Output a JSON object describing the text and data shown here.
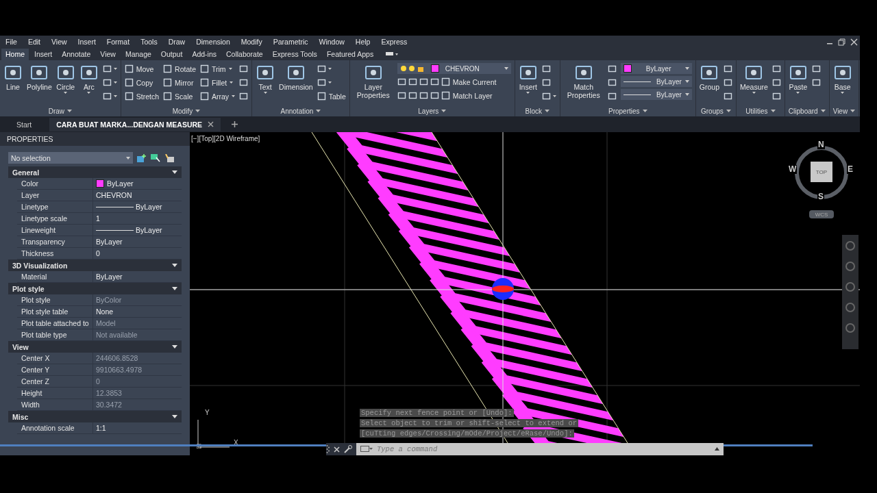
{
  "menu": [
    "File",
    "Edit",
    "View",
    "Insert",
    "Format",
    "Tools",
    "Draw",
    "Dimension",
    "Modify",
    "Parametric",
    "Window",
    "Help",
    "Express"
  ],
  "ribbon_tabs": [
    {
      "label": "Home",
      "selected": true
    },
    {
      "label": "Insert",
      "selected": false
    },
    {
      "label": "Annotate",
      "selected": false
    },
    {
      "label": "View",
      "selected": false
    },
    {
      "label": "Manage",
      "selected": false
    },
    {
      "label": "Output",
      "selected": false
    },
    {
      "label": "Add-ins",
      "selected": false
    },
    {
      "label": "Collaborate",
      "selected": false
    },
    {
      "label": "Express Tools",
      "selected": false
    },
    {
      "label": "Featured Apps",
      "selected": false
    }
  ],
  "panels": [
    {
      "title": "Draw",
      "columns": [
        [
          {
            "kind": "large",
            "label": "Line",
            "caret": false
          }
        ],
        [
          {
            "kind": "large",
            "label": "Polyline",
            "caret": false
          }
        ],
        [
          {
            "kind": "large",
            "label": "Circle",
            "caret": true
          }
        ],
        [
          {
            "kind": "large",
            "label": "Arc",
            "caret": true
          }
        ],
        [
          {
            "kind": "icon",
            "caret": true
          },
          {
            "kind": "icon",
            "caret": true
          },
          {
            "kind": "icon",
            "caret": true
          }
        ]
      ]
    },
    {
      "title": "Modify",
      "columns": [
        [
          {
            "kind": "small",
            "label": "Move",
            "caret": false
          },
          {
            "kind": "small",
            "label": "Copy",
            "caret": false
          },
          {
            "kind": "small",
            "label": "Stretch",
            "caret": false
          }
        ],
        [
          {
            "kind": "small",
            "label": "Rotate",
            "caret": false
          },
          {
            "kind": "small",
            "label": "Mirror",
            "caret": false
          },
          {
            "kind": "small",
            "label": "Scale",
            "caret": false
          }
        ],
        [
          {
            "kind": "small",
            "label": "Trim",
            "caret": true
          },
          {
            "kind": "small",
            "label": "Fillet",
            "caret": true
          },
          {
            "kind": "small",
            "label": "Array",
            "caret": true
          }
        ],
        [
          {
            "kind": "icon",
            "caret": false
          },
          {
            "kind": "icon",
            "caret": false
          },
          {
            "kind": "icon",
            "caret": false
          }
        ]
      ]
    },
    {
      "title": "Annotation",
      "columns": [
        [
          {
            "kind": "large",
            "label": "Text",
            "caret": true
          }
        ],
        [
          {
            "kind": "large",
            "label": "Dimension",
            "caret": false
          }
        ],
        [
          {
            "kind": "icon",
            "caret": true
          },
          {
            "kind": "icon",
            "caret": true
          },
          {
            "kind": "small",
            "label": "Table",
            "caret": false
          }
        ]
      ]
    },
    {
      "title": "Layers",
      "columns": [
        [
          {
            "kind": "large",
            "label": "Layer Properties",
            "caret": false
          }
        ],
        [
          {
            "kind": "layerpick",
            "value": "CHEVRON"
          },
          {
            "kind": "row",
            "items": [
              {
                "kind": "icon",
                "caret": false
              },
              {
                "kind": "icon",
                "caret": false
              },
              {
                "kind": "icon",
                "caret": false
              },
              {
                "kind": "icon",
                "caret": false
              },
              {
                "kind": "small",
                "label": "Make Current",
                "caret": false
              }
            ]
          },
          {
            "kind": "row",
            "items": [
              {
                "kind": "icon",
                "caret": false
              },
              {
                "kind": "icon",
                "caret": false
              },
              {
                "kind": "icon",
                "caret": false
              },
              {
                "kind": "icon",
                "caret": false
              },
              {
                "kind": "small",
                "label": "Match Layer",
                "caret": false
              }
            ]
          }
        ]
      ]
    },
    {
      "title": "Block",
      "columns": [
        [
          {
            "kind": "large",
            "label": "Insert",
            "caret": true
          }
        ],
        [
          {
            "kind": "icon",
            "caret": false
          },
          {
            "kind": "icon",
            "caret": false
          },
          {
            "kind": "icon",
            "caret": true
          }
        ]
      ]
    },
    {
      "title": "Properties",
      "columns": [
        [
          {
            "kind": "large",
            "label": "Match Properties",
            "caret": false
          }
        ],
        [
          {
            "kind": "icon",
            "caret": false
          },
          {
            "kind": "icon",
            "caret": false
          },
          {
            "kind": "icon",
            "caret": false
          }
        ],
        [
          {
            "kind": "colorpick",
            "value": "ByLayer"
          },
          {
            "kind": "linepick",
            "value": "ByLayer"
          },
          {
            "kind": "linepick",
            "value": "ByLayer"
          }
        ]
      ]
    },
    {
      "title": "Groups",
      "columns": [
        [
          {
            "kind": "large",
            "label": "Group",
            "caret": false
          }
        ],
        [
          {
            "kind": "icon",
            "caret": false
          },
          {
            "kind": "icon",
            "caret": false
          },
          {
            "kind": "icon",
            "caret": false
          }
        ]
      ]
    },
    {
      "title": "Utilities",
      "columns": [
        [
          {
            "kind": "large",
            "label": "Measure",
            "caret": true
          }
        ],
        [
          {
            "kind": "icon",
            "caret": false
          },
          {
            "kind": "icon",
            "caret": false
          },
          {
            "kind": "icon",
            "caret": false
          }
        ]
      ]
    },
    {
      "title": "Clipboard",
      "columns": [
        [
          {
            "kind": "large",
            "label": "Paste",
            "caret": true
          }
        ],
        [
          {
            "kind": "icon",
            "caret": false
          },
          {
            "kind": "icon",
            "caret": false
          }
        ]
      ]
    },
    {
      "title": "View",
      "columns": [
        [
          {
            "kind": "large",
            "label": "Base",
            "caret": true
          }
        ]
      ]
    }
  ],
  "file_tabs": [
    {
      "label": "Start",
      "selected": false
    },
    {
      "label": "CARA BUAT MARKA...DENGAN MEASURE",
      "selected": true
    }
  ],
  "properties": {
    "title": "PROPERTIES",
    "selection": "No selection",
    "sections": [
      {
        "title": "General",
        "expanded": true,
        "rows": [
          {
            "label": "Color",
            "value": "ByLayer",
            "kind": "color",
            "disabled": false
          },
          {
            "label": "Layer",
            "value": "CHEVRON",
            "kind": "text",
            "disabled": false
          },
          {
            "label": "Linetype",
            "value": "ByLayer",
            "kind": "line",
            "disabled": false
          },
          {
            "label": "Linetype scale",
            "value": "1",
            "kind": "text",
            "disabled": false
          },
          {
            "label": "Lineweight",
            "value": "ByLayer",
            "kind": "line",
            "disabled": false
          },
          {
            "label": "Transparency",
            "value": "ByLayer",
            "kind": "text",
            "disabled": false
          },
          {
            "label": "Thickness",
            "value": "0",
            "kind": "text",
            "disabled": false
          }
        ]
      },
      {
        "title": "3D Visualization",
        "expanded": true,
        "rows": [
          {
            "label": "Material",
            "value": "ByLayer",
            "kind": "text",
            "disabled": false
          }
        ]
      },
      {
        "title": "Plot style",
        "expanded": true,
        "rows": [
          {
            "label": "Plot style",
            "value": "ByColor",
            "kind": "text",
            "disabled": true
          },
          {
            "label": "Plot style table",
            "value": "None",
            "kind": "text",
            "disabled": false
          },
          {
            "label": "Plot table attached to",
            "value": "Model",
            "kind": "text",
            "disabled": true
          },
          {
            "label": "Plot table type",
            "value": "Not available",
            "kind": "text",
            "disabled": true
          }
        ]
      },
      {
        "title": "View",
        "expanded": true,
        "rows": [
          {
            "label": "Center X",
            "value": "244606.8528",
            "kind": "text",
            "disabled": true
          },
          {
            "label": "Center Y",
            "value": "9910663.4978",
            "kind": "text",
            "disabled": true
          },
          {
            "label": "Center Z",
            "value": "0",
            "kind": "text",
            "disabled": true
          },
          {
            "label": "Height",
            "value": "12.3853",
            "kind": "text",
            "disabled": true
          },
          {
            "label": "Width",
            "value": "30.3472",
            "kind": "text",
            "disabled": true
          }
        ]
      },
      {
        "title": "Misc",
        "expanded": true,
        "rows": [
          {
            "label": "Annotation scale",
            "value": "1:1",
            "kind": "text",
            "disabled": false
          }
        ]
      }
    ]
  },
  "viewport": {
    "label": "[−][Top][2D Wireframe]",
    "viewcube": {
      "top": "TOP",
      "north": "N",
      "south": "S",
      "east": "E",
      "west": "W",
      "wcs": "WCS"
    },
    "ucs": {
      "x": "X",
      "y": "Y"
    }
  },
  "command_history": [
    "Specify next fence point or [Undo]:",
    "Select object to trim or shift-select to extend or",
    "[cuTting edges/Crossing/mOde/Project/eRase/Undo]:"
  ],
  "command_line": {
    "placeholder": "Type a command"
  }
}
